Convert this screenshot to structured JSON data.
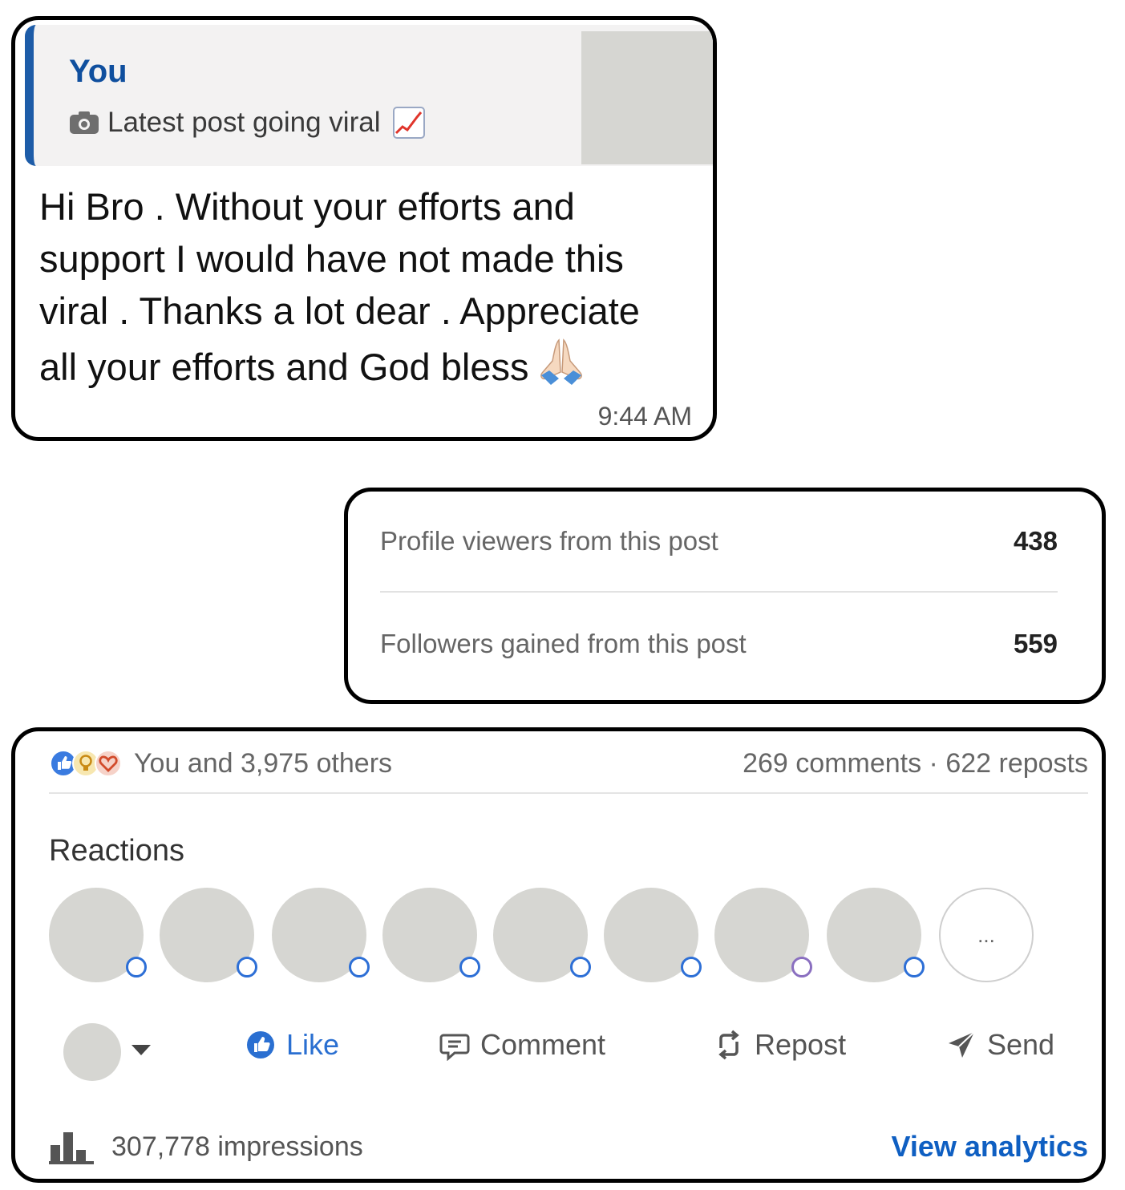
{
  "message": {
    "quote_author": "You",
    "quote_text": "Latest post going viral",
    "body_lines": [
      "Hi Bro . Without your efforts and",
      "support I would have not made this",
      "viral . Thanks a lot dear . Appreciate",
      "all your efforts and God bless"
    ],
    "time": "9:44 AM",
    "colors": {
      "quote_bar": "#1d5ca8",
      "author": "#0f4f9e"
    }
  },
  "stats": {
    "rows": [
      {
        "label": "Profile viewers from this post",
        "value": "438"
      },
      {
        "label": "Followers gained from this post",
        "value": "559"
      }
    ]
  },
  "social": {
    "reactors_text": "You and 3,975 others",
    "comments_reposts": "269 comments · 622 reposts",
    "reactions_heading": "Reactions",
    "more_label": "...",
    "actions": [
      {
        "label": "Like",
        "icon": "like-icon"
      },
      {
        "label": "Comment",
        "icon": "comment-icon"
      },
      {
        "label": "Repost",
        "icon": "repost-icon"
      },
      {
        "label": "Send",
        "icon": "send-icon"
      }
    ],
    "impressions": "307,778 impressions",
    "view_analytics": "View analytics",
    "colors": {
      "like": "#2a6fd1",
      "link": "#0f5fc2"
    }
  }
}
